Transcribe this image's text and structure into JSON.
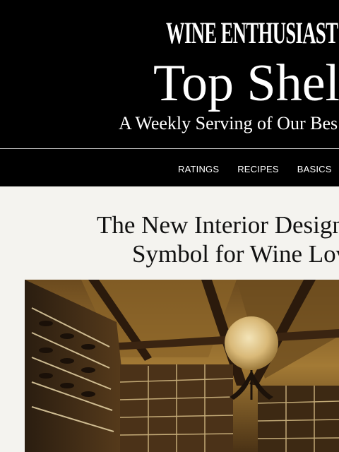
{
  "header": {
    "logo": "WINE ENTHUSIAST",
    "title": "Top Shel",
    "tagline": "A Weekly Serving of Our Bes"
  },
  "nav": {
    "items": [
      "RATINGS",
      "RECIPES",
      "BASICS"
    ]
  },
  "article": {
    "headline_line1": "The New Interior Design",
    "headline_line2": "Symbol for Wine Lov",
    "hero_image": "wine-cellar-interior-photo"
  },
  "colors": {
    "header_bg": "#000000",
    "page_bg": "#f4f3ef",
    "text_dark": "#111111"
  }
}
